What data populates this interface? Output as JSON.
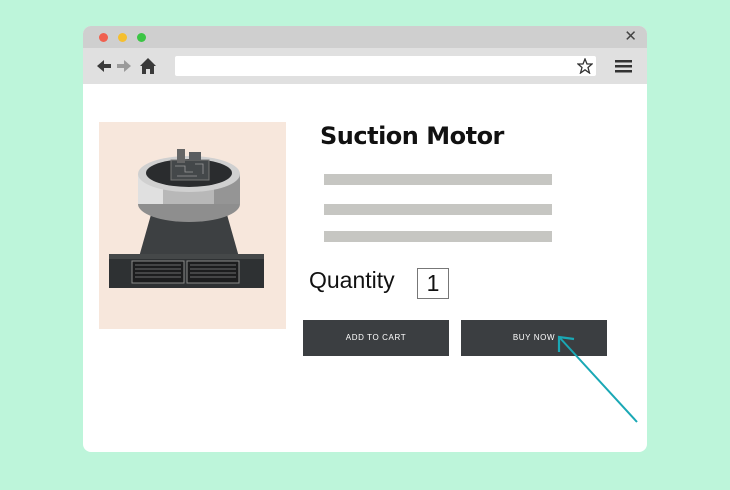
{
  "product": {
    "title": "Suction Motor",
    "quantity_label": "Quantity",
    "quantity_value": "1",
    "add_to_cart_label": "ADD TO CART",
    "buy_now_label": "BUY NOW"
  },
  "colors": {
    "background": "#bdf5da",
    "button": "#3b3e41",
    "arrow": "#1aa8b5",
    "image_bg": "#f7e7dc"
  },
  "icons": [
    "back-arrow-icon",
    "forward-arrow-icon",
    "home-icon",
    "star-icon",
    "hamburger-menu-icon",
    "close-icon"
  ]
}
